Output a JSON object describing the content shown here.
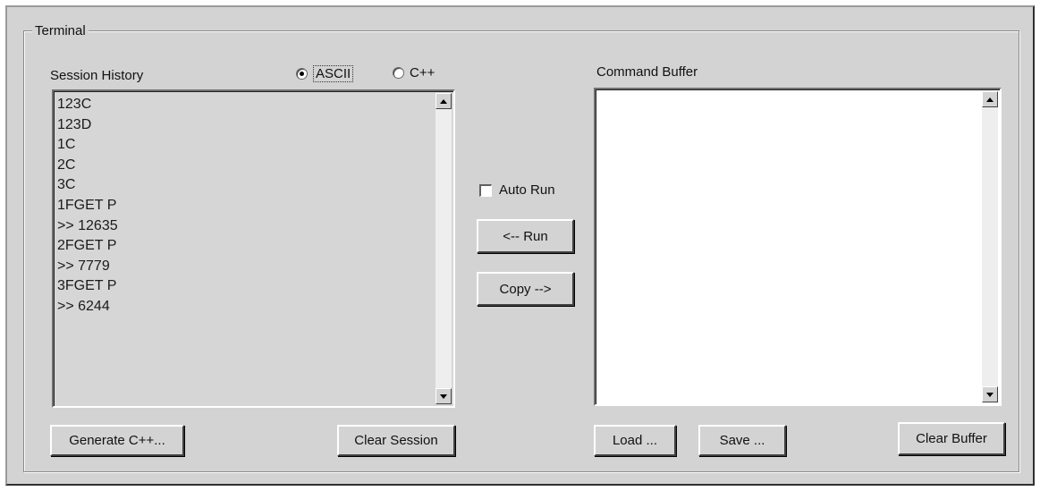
{
  "terminal": {
    "group_title": "Terminal",
    "session_history": {
      "label": "Session History",
      "lines": [
        "123C",
        "123D",
        "1C",
        "2C",
        "3C",
        "1FGET P",
        ">> 12635",
        "2FGET P",
        ">> 7779",
        "3FGET P",
        ">> 6244"
      ]
    },
    "format": {
      "options": [
        "ASCII",
        "C++"
      ],
      "selected": "ASCII"
    },
    "command_buffer": {
      "label": "Command Buffer",
      "content": ""
    },
    "auto_run": {
      "label": "Auto Run",
      "checked": false
    },
    "buttons": {
      "run": "<-- Run",
      "copy": "Copy -->",
      "generate": "Generate C++...",
      "clear_session": "Clear Session",
      "load": "Load ...",
      "save": "Save ...",
      "clear_buffer": "Clear Buffer"
    }
  }
}
